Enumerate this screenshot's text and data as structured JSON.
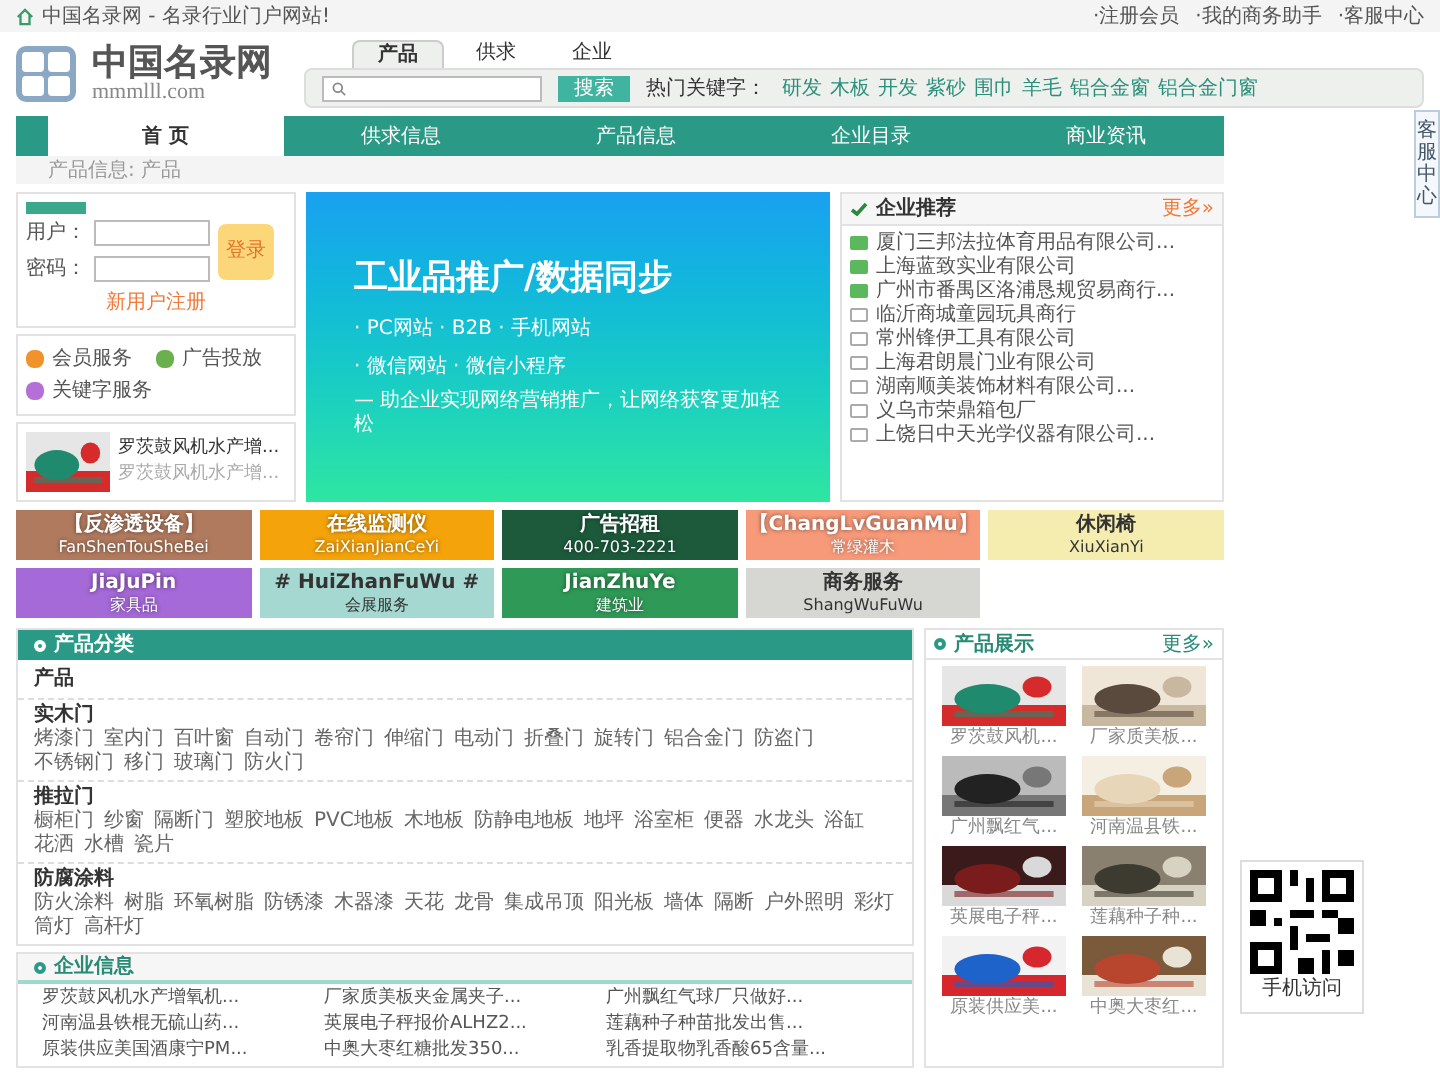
{
  "top_bar": {
    "site_slogan": "中国名录网 - 名录行业门户网站!",
    "links": [
      "·注册会员",
      "·我的商务助手",
      "·客服中心"
    ]
  },
  "header": {
    "logo_title": "中国名录网",
    "logo_domain": "mmmlll.com",
    "search_tabs": [
      {
        "label": "产品",
        "selected": true
      },
      {
        "label": "供求",
        "selected": false
      },
      {
        "label": "企业",
        "selected": false
      }
    ],
    "search_button": "搜索",
    "hot_label": "热门关键字：",
    "hot_keywords": [
      "研发",
      "木板",
      "开发",
      "紫砂",
      "围巾",
      "羊毛",
      "铝合金窗",
      "铝合金门窗"
    ]
  },
  "nav": [
    {
      "label": "首 页",
      "selected": true
    },
    {
      "label": "供求信息",
      "selected": false
    },
    {
      "label": "产品信息",
      "selected": false
    },
    {
      "label": "企业目录",
      "selected": false
    },
    {
      "label": "商业资讯",
      "selected": false
    }
  ],
  "breadcrumb": "产品信息: 产品",
  "login": {
    "user_label": "用户：",
    "password_label": "密码：",
    "login_button": "登录",
    "register_link": "新用户注册"
  },
  "services": [
    {
      "label": "会员服务",
      "color": "#f0932b"
    },
    {
      "label": "广告投放",
      "color": "#6ab04c"
    },
    {
      "label": "关键字服务",
      "color": "#b56fd6"
    }
  ],
  "featured_product": {
    "title": "罗茨鼓风机水产增...",
    "subtitle": "罗茨鼓风机水产增..."
  },
  "banner": {
    "headline": "工业品推广/数据同步",
    "line_1": "· PC网站 · B2B · 手机网站",
    "line_2": "· 微信网站 · 微信小程序",
    "tagline": "— 助企业实现网络营销推广，让网络获客更加轻松"
  },
  "recommended": {
    "title": "企业推荐",
    "more": "更多»",
    "items": [
      {
        "name": "厦门三邦法拉体育用品有限公司...",
        "featured": true
      },
      {
        "name": "上海蓝致实业有限公司",
        "featured": true
      },
      {
        "name": "广州市番禺区洛浦恳规贸易商行...",
        "featured": true
      },
      {
        "name": "临沂商城童园玩具商行",
        "featured": false
      },
      {
        "name": "常州锋伊工具有限公司",
        "featured": false
      },
      {
        "name": "上海君朗晨门业有限公司",
        "featured": false
      },
      {
        "name": "湖南顺美装饰材料有限公司...",
        "featured": false
      },
      {
        "name": "义乌市荣鼎箱包厂",
        "featured": false
      },
      {
        "name": "上饶日中天光学仪器有限公司...",
        "featured": false
      }
    ]
  },
  "tiles": [
    {
      "top": "【反渗透设备】",
      "bottom": "FanShenTouSheBei",
      "color": "#b07a5e"
    },
    {
      "top": "在线监测仪",
      "bottom": "ZaiXianJianCeYi",
      "color": "#f5a30a"
    },
    {
      "top": "广告招租",
      "bottom": "400-703-2221",
      "color": "#1d5a3c"
    },
    {
      "top": "【ChangLvGuanMu】",
      "bottom": "常绿灌木",
      "color": "#f79a7a"
    },
    {
      "top": "休闲椅",
      "bottom": "XiuXianYi",
      "color": "#f5ecb0"
    },
    {
      "top": "JiaJuPin",
      "bottom": "家具品",
      "color": "#a569d8"
    },
    {
      "top": "# HuiZhanFuWu #",
      "bottom": "会展服务",
      "color": "#a5d8d0"
    },
    {
      "top": "JianZhuYe",
      "bottom": "建筑业",
      "color": "#2f9a57"
    },
    {
      "top": "商务服务",
      "bottom": "ShangWuFuWu",
      "color": "#d6d6d2"
    }
  ],
  "categories": {
    "title": "产品分类",
    "root": "产品",
    "groups": [
      {
        "name": "实木门",
        "items": [
          "烤漆门",
          "室内门",
          "百叶窗",
          "自动门",
          "卷帘门",
          "伸缩门",
          "电动门",
          "折叠门",
          "旋转门",
          "铝合金门",
          "防盗门",
          "不锈钢门",
          "移门",
          "玻璃门",
          "防火门"
        ]
      },
      {
        "name": "推拉门",
        "items": [
          "橱柜门",
          "纱窗",
          "隔断门",
          "塑胶地板",
          "PVC地板",
          "木地板",
          "防静电地板",
          "地坪",
          "浴室柜",
          "便器",
          "水龙头",
          "浴缸",
          "花洒",
          "水槽",
          "瓷片"
        ]
      },
      {
        "name": "防腐涂料",
        "items": [
          "防火涂料",
          "树脂",
          "环氧树脂",
          "防锈漆",
          "木器漆",
          "天花",
          "龙骨",
          "集成吊顶",
          "阳光板",
          "墙体",
          "隔断",
          "户外照明",
          "彩灯",
          "筒灯",
          "高杆灯"
        ]
      }
    ]
  },
  "company_info": {
    "title": "企业信息",
    "items": [
      "罗茨鼓风机水产增氧机...",
      "厂家质美板夹金属夹子...",
      "广州飘红气球厂只做好...",
      "河南温县铁棍无硫山药...",
      "英展电子秤报价ALHZ2...",
      "莲藕种子种苗批发出售...",
      "原装供应美国酒康宁PM...",
      "中奥大枣红糖批发350...",
      "乳香提取物乳香酸65含量..."
    ]
  },
  "showcase": {
    "title": "产品展示",
    "more": "更多»",
    "items": [
      "罗茨鼓风机...",
      "厂家质美板...",
      "广州飘红气...",
      "河南温县铁...",
      "英展电子秤...",
      "莲藕种子种...",
      "原装供应美...",
      "中奥大枣红..."
    ]
  },
  "qr": {
    "caption": "手机访问"
  },
  "side_tab": {
    "label": "客服中心"
  }
}
